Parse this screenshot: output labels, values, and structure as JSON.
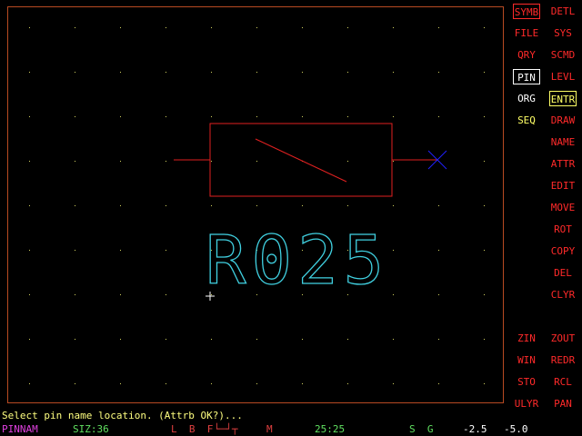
{
  "menu": {
    "col1": [
      {
        "label": "SYMB",
        "color": "red",
        "boxed": true
      },
      {
        "label": "FILE",
        "color": "red"
      },
      {
        "label": "QRY",
        "color": "red"
      },
      {
        "label": "PIN",
        "color": "white",
        "boxed": true
      },
      {
        "label": "ORG",
        "color": "white"
      },
      {
        "label": "SEQ",
        "color": "yellow"
      }
    ],
    "col2": [
      {
        "label": "DETL",
        "color": "red"
      },
      {
        "label": "SYS",
        "color": "red"
      },
      {
        "label": "SCMD",
        "color": "red"
      },
      {
        "label": "LEVL",
        "color": "red"
      },
      {
        "label": "ENTR",
        "color": "yellow",
        "boxed": true
      },
      {
        "label": "DRAW",
        "color": "red"
      },
      {
        "label": "NAME",
        "color": "red"
      },
      {
        "label": "ATTR",
        "color": "red"
      },
      {
        "label": "EDIT",
        "color": "red"
      },
      {
        "label": "MOVE",
        "color": "red"
      },
      {
        "label": "ROT",
        "color": "red"
      },
      {
        "label": "COPY",
        "color": "red"
      },
      {
        "label": "DEL",
        "color": "red"
      },
      {
        "label": "CLYR",
        "color": "red"
      }
    ],
    "view_col1": [
      "ZIN",
      "WIN",
      "STO",
      "ULYR"
    ],
    "view_col2": [
      "ZOUT",
      "REDR",
      "RCL",
      "PAN"
    ]
  },
  "canvas": {
    "symbol_label": "R025"
  },
  "status": {
    "message": "Select pin name location. (Attrb OK?)..."
  },
  "bottom_bar": {
    "mode": "PINNAM",
    "size": "SIZ:36",
    "flags": "L  B  F",
    "flag_m": "M",
    "time": "25:25",
    "snap": "S  G",
    "x": "-2.5",
    "y": "-5.0"
  },
  "colors": {
    "frame": "#b84a22",
    "menu_red": "#ff2a2a",
    "menu_yellow": "#ffff66",
    "symbol": "#e02020",
    "label": "#40d0e0",
    "pin_marker": "#2020ff",
    "grid_dot": "#d0d060"
  }
}
